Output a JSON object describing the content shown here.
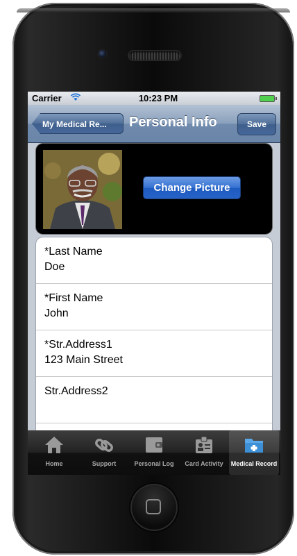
{
  "status_bar": {
    "carrier": "Carrier",
    "time": "10:23 PM"
  },
  "nav": {
    "back_label": "My Medical Re...",
    "title": "Personal Info",
    "save_label": "Save"
  },
  "photo": {
    "change_label": "Change Picture"
  },
  "fields": [
    {
      "label": "*Last Name",
      "value": "Doe"
    },
    {
      "label": "*First Name",
      "value": "John"
    },
    {
      "label": "*Str.Address1",
      "value": "123 Main Street"
    },
    {
      "label": "Str.Address2",
      "value": ""
    }
  ],
  "tabs": [
    {
      "label": "Home",
      "icon": "home-icon"
    },
    {
      "label": "Support",
      "icon": "link-icon"
    },
    {
      "label": "Personal Log",
      "icon": "wallet-icon"
    },
    {
      "label": "Card Activity",
      "icon": "id-card-icon"
    },
    {
      "label": "Medical Record",
      "icon": "medical-folder-icon",
      "active": true
    }
  ],
  "colors": {
    "nav_bar": "#7b93b3",
    "accent_button": "#2f6bd0",
    "tab_active": "#5aa8e8"
  }
}
